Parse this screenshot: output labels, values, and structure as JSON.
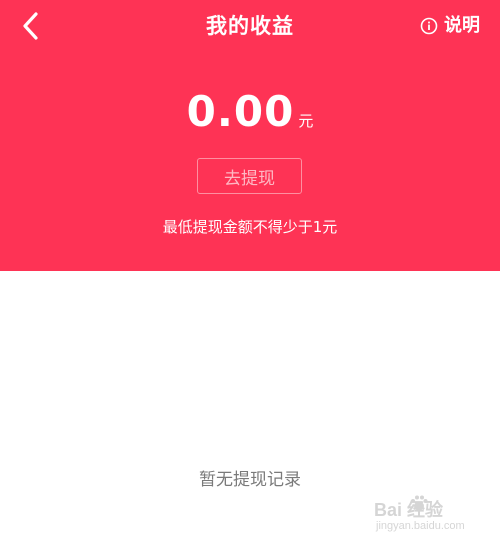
{
  "header": {
    "title": "我的收益",
    "help_label": "说明",
    "back_icon": "chevron-left-icon",
    "help_icon": "info-icon",
    "background_color": "#fe3355"
  },
  "balance": {
    "amount": "0.00",
    "unit": "元"
  },
  "withdraw": {
    "label": "去提现"
  },
  "note": {
    "min_withdraw": "最低提现金额不得少于1元"
  },
  "records": {
    "empty_text": "暂无提现记录"
  },
  "watermark": {
    "brand": "Bai  经验",
    "url": "jingyan.baidu.com"
  }
}
